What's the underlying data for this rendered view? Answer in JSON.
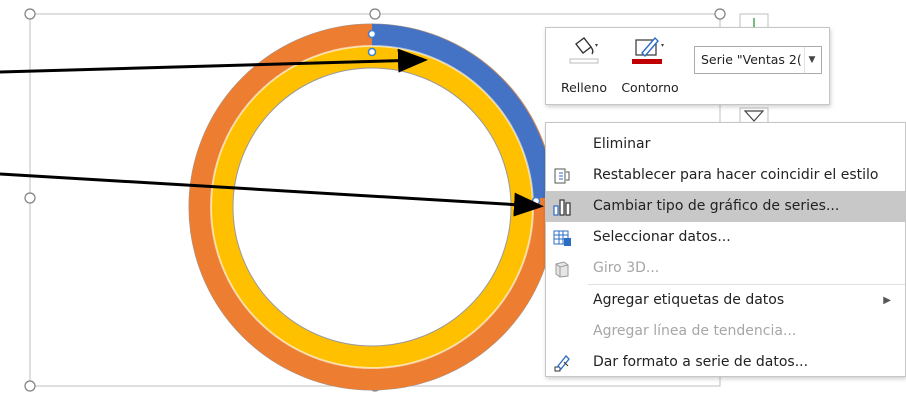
{
  "chart_data": {
    "type": "doughnut",
    "series": [
      {
        "name": "",
        "color": "#ED7D31"
      },
      {
        "name": "",
        "color": "#FFC000"
      },
      {
        "name": "Ventas 2",
        "color": "#4472C4"
      }
    ]
  },
  "mini_toolbar": {
    "fill_label": "Relleno",
    "outline_label": "Contorno",
    "series_value": "Serie \"Ventas 2(",
    "fill_icon": "paint-bucket-icon",
    "outline_icon": "pen-outline-icon",
    "outline_color": "#C00000"
  },
  "context_menu": {
    "items": [
      {
        "label": "Eliminar",
        "icon": "",
        "disabled": false
      },
      {
        "label": "Restablecer para hacer coincidir el estilo",
        "icon": "reset-style-icon",
        "disabled": false
      },
      {
        "label": "Cambiar tipo de gráfico de series...",
        "icon": "chart-type-icon",
        "disabled": false,
        "highlighted": true
      },
      {
        "label": "Seleccionar datos...",
        "icon": "select-data-icon",
        "disabled": false
      },
      {
        "label": "Giro 3D...",
        "icon": "rotate-3d-icon",
        "disabled": true
      },
      {
        "label": "Agregar etiquetas de datos",
        "icon": "",
        "disabled": false,
        "submenu": true
      },
      {
        "label": "Agregar línea de tendencia...",
        "icon": "",
        "disabled": true
      },
      {
        "label": "Dar formato a serie de datos...",
        "icon": "format-series-icon",
        "disabled": false
      }
    ]
  },
  "colors": {
    "orange": "#ED7D31",
    "yellow": "#FFC000",
    "blue": "#4472C4",
    "highlight": "#C8C8C8"
  }
}
